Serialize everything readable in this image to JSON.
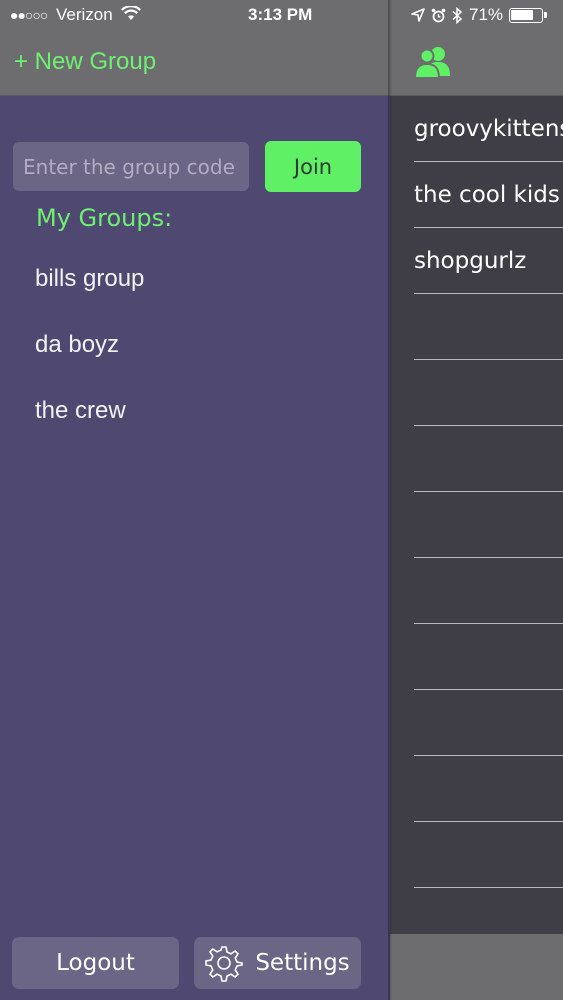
{
  "status_bar": {
    "carrier": "Verizon",
    "signal_dots": "●●○○○",
    "time": "3:13 PM",
    "battery": "71%"
  },
  "drawer": {
    "new_group_label": "+ New Group",
    "code_placeholder": "Enter the group code",
    "join_label": "Join",
    "my_groups_title": "My Groups:",
    "groups": [
      "bills group",
      "da boyz",
      "the crew"
    ],
    "logout_label": "Logout",
    "settings_label": "Settings"
  },
  "main": {
    "header_icon": "people-icon",
    "chats": [
      "groovykittens",
      "the cool kids",
      "shopgurlz",
      "",
      "",
      "",
      "",
      "",
      "",
      "",
      "",
      "",
      ""
    ]
  },
  "colors": {
    "accent_green": "#6ef073",
    "drawer_purple": "#4f4870",
    "header_gray": "#6d6d6f",
    "main_dark": "#3f3e46"
  }
}
